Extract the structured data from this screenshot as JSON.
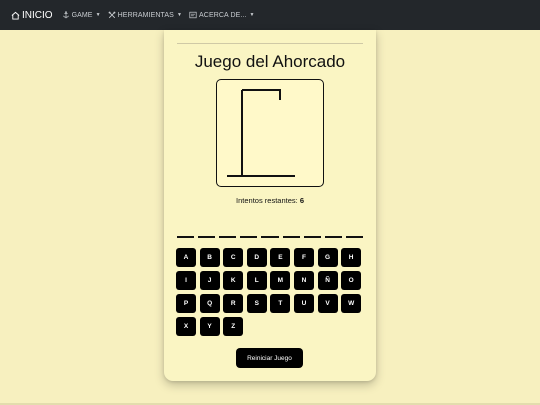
{
  "navbar": {
    "brand_label": "INICIO",
    "items": [
      {
        "label": "GAME",
        "icon": "anchor-icon"
      },
      {
        "label": "HERRAMIENTAS",
        "icon": "tools-icon"
      },
      {
        "label": "ACERCA DE...",
        "icon": "document-icon"
      }
    ]
  },
  "game": {
    "title": "Juego del Ahorcado",
    "attempts_label": "Intentos restantes:",
    "attempts_value": "6",
    "word_slot_count": 9,
    "keys": [
      "A",
      "B",
      "C",
      "D",
      "E",
      "F",
      "G",
      "H",
      "I",
      "J",
      "K",
      "L",
      "M",
      "N",
      "Ñ",
      "O",
      "P",
      "Q",
      "R",
      "S",
      "T",
      "U",
      "V",
      "W",
      "X",
      "Y",
      "Z"
    ],
    "reset_label": "Reiniciar Juego"
  },
  "colors": {
    "navbar_bg": "#23272b",
    "page_bg": "#f7f0bf",
    "card_bg": "#faf5c3",
    "button_bg": "#000000"
  }
}
